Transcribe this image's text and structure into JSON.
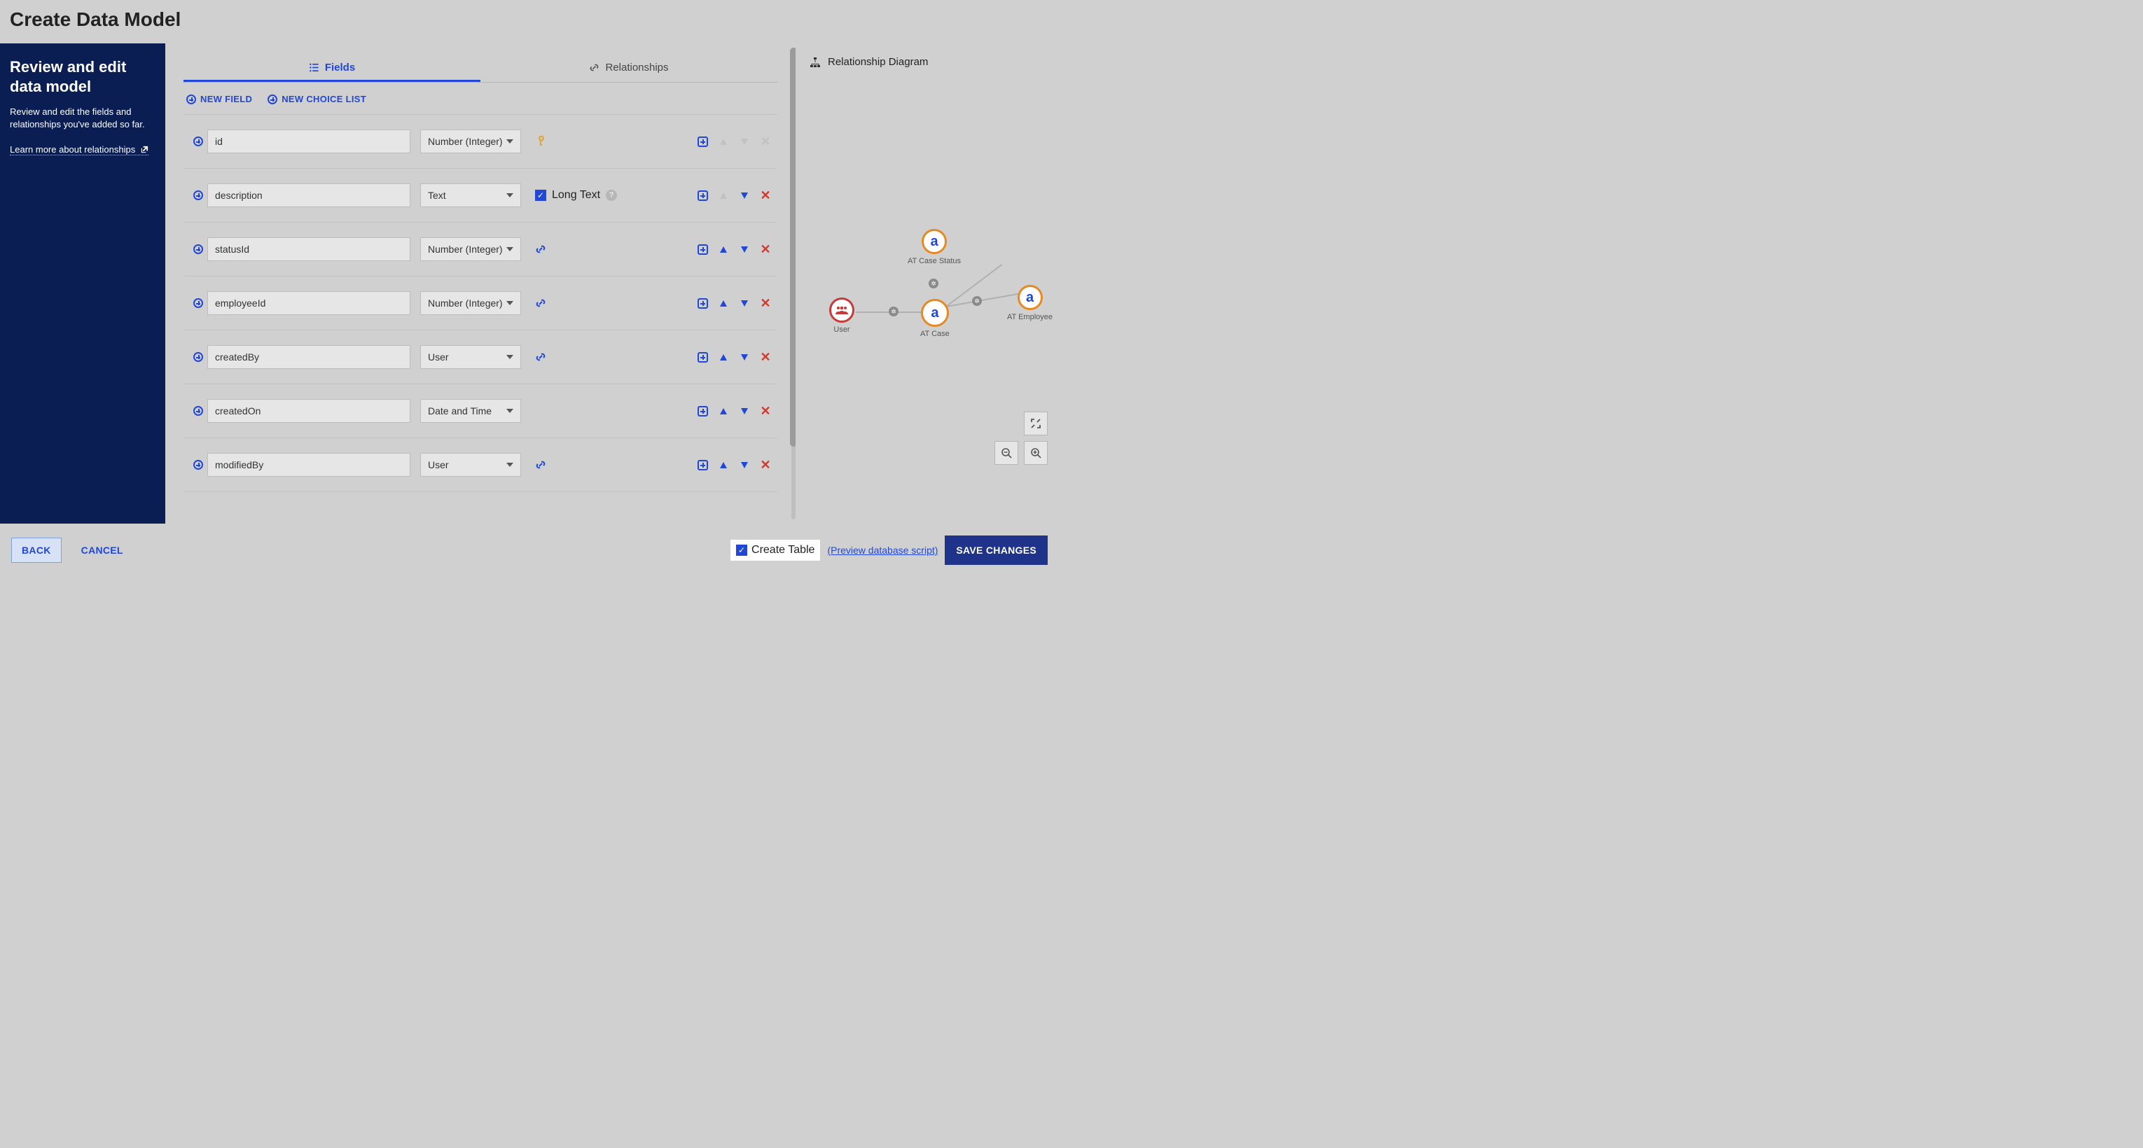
{
  "title": "Create Data Model",
  "sidebar": {
    "heading": "Review and edit data model",
    "body": "Review and edit the fields and relationships you've added so far.",
    "learn_label": "Learn more about relationships"
  },
  "tabs": {
    "fields_label": "Fields",
    "relationships_label": "Relationships"
  },
  "toolbar": {
    "new_field_label": "NEW FIELD",
    "new_choice_label": "NEW CHOICE LIST"
  },
  "fields": [
    {
      "name": "id",
      "type": "Number (Integer)",
      "key": true,
      "link": false,
      "long_text": false,
      "up": false,
      "down": false,
      "del": false
    },
    {
      "name": "description",
      "type": "Text",
      "key": false,
      "link": false,
      "long_text": true,
      "up": false,
      "down": true,
      "del": true
    },
    {
      "name": "statusId",
      "type": "Number (Integer)",
      "key": false,
      "link": true,
      "long_text": false,
      "up": true,
      "down": true,
      "del": true
    },
    {
      "name": "employeeId",
      "type": "Number (Integer)",
      "key": false,
      "link": true,
      "long_text": false,
      "up": true,
      "down": true,
      "del": true
    },
    {
      "name": "createdBy",
      "type": "User",
      "key": false,
      "link": true,
      "long_text": false,
      "up": true,
      "down": true,
      "del": true
    },
    {
      "name": "createdOn",
      "type": "Date and Time",
      "key": false,
      "link": false,
      "long_text": false,
      "up": true,
      "down": true,
      "del": true
    },
    {
      "name": "modifiedBy",
      "type": "User",
      "key": false,
      "link": true,
      "long_text": false,
      "up": true,
      "down": true,
      "del": true
    }
  ],
  "long_text_label": "Long Text",
  "right_panel": {
    "heading": "Relationship Diagram"
  },
  "diagram": {
    "nodes": {
      "status": {
        "label": "AT Case Status",
        "glyph": "a"
      },
      "employee": {
        "label": "AT Employee",
        "glyph": "a"
      },
      "case": {
        "label": "AT Case",
        "glyph": "a"
      },
      "user": {
        "label": "User"
      }
    }
  },
  "footer": {
    "back_label": "BACK",
    "cancel_label": "CANCEL",
    "create_table_label": "Create Table",
    "preview_label": "(Preview database script)",
    "save_label": "SAVE CHANGES"
  }
}
